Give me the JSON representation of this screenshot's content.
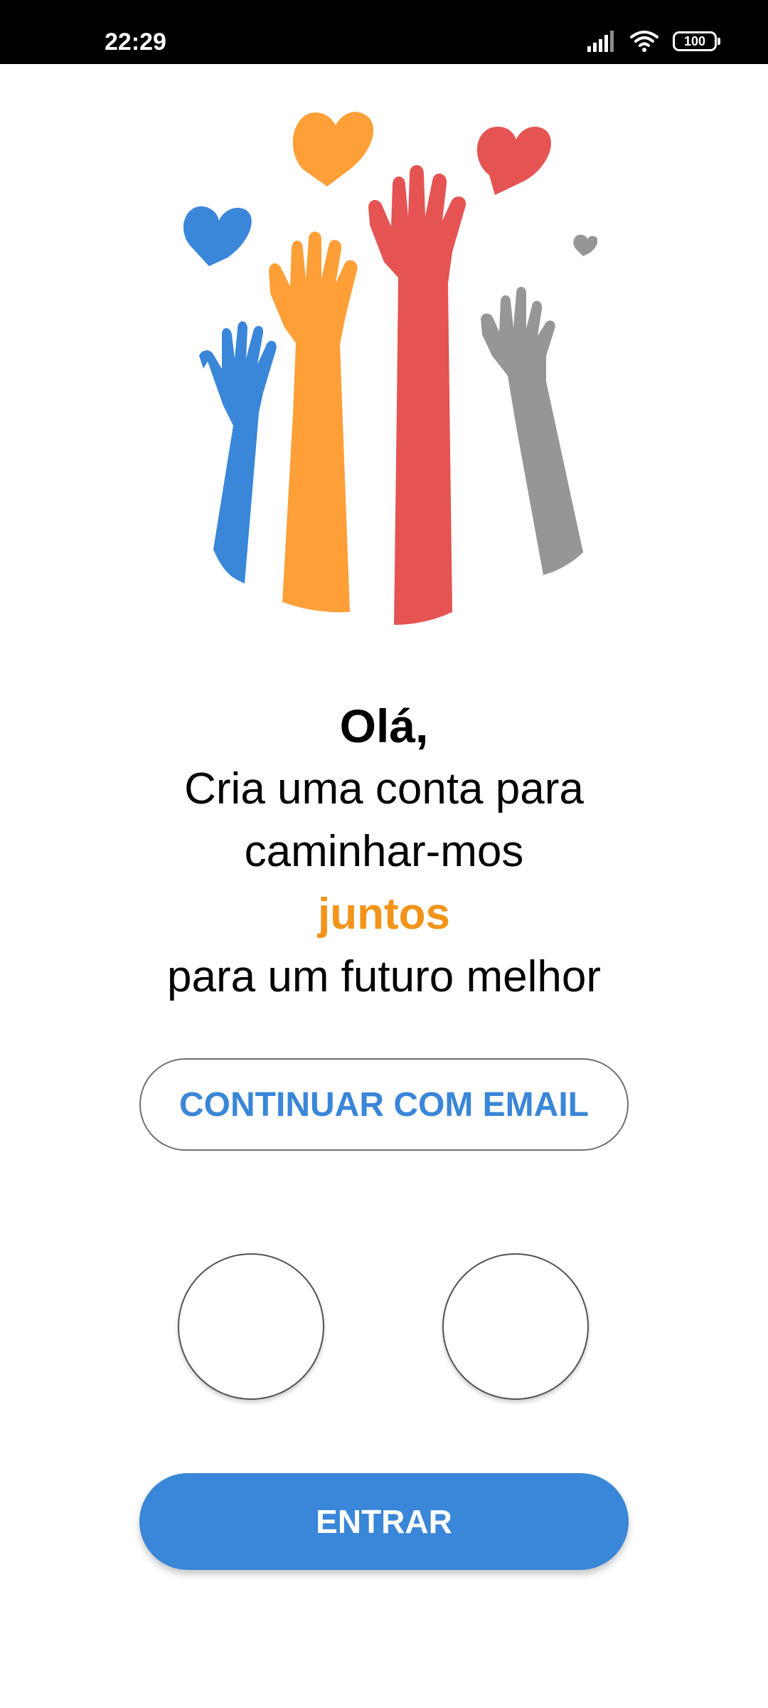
{
  "status_bar": {
    "time": "22:29",
    "battery": "100",
    "icons": [
      "signal-icon",
      "wifi-icon",
      "battery-icon"
    ]
  },
  "illustration": {
    "name": "raised-hands-hearts",
    "colors": {
      "blue": "#3a86d8",
      "orange": "#ff9f38",
      "red": "#e55353",
      "gray": "#969696"
    }
  },
  "greeting": {
    "title": "Olá,",
    "line1": "Cria uma conta para",
    "line2": "caminhar-mos",
    "highlight": "juntos",
    "line3": "para um futuro melhor"
  },
  "buttons": {
    "email": "CONTINUAR COM EMAIL",
    "enter": "ENTRAR"
  },
  "colors": {
    "accent": "#3a86d8",
    "highlight": "#f2941a"
  }
}
